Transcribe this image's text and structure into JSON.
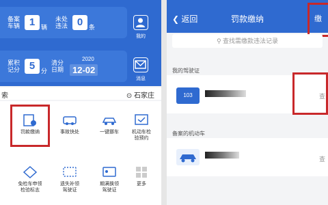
{
  "left": {
    "vehicle_card": {
      "label1": "备案\n车辆",
      "count1": "1",
      "label1b": "辆",
      "label2": "未处\n违法",
      "count2": "0",
      "label2b": "条"
    },
    "points_card": {
      "label1": "累积\n记分",
      "count1": "5",
      "label1b": "分",
      "label2": "清分\n日期",
      "year": "2020",
      "date": "12-02"
    },
    "side_mine": "我的",
    "side_msg": "消息",
    "search_partial": "索",
    "city": "石家庄",
    "tiles": [
      {
        "label": "罚款缴纳"
      },
      {
        "label": "事故快处"
      },
      {
        "label": "一键挪车"
      },
      {
        "label": "机动车检\n验预约"
      },
      {
        "label": "免检车申领\n检验标志"
      },
      {
        "label": "遗失补领\n驾驶证"
      },
      {
        "label": "期满换领\n驾驶证"
      },
      {
        "label": "更多"
      }
    ]
  },
  "right": {
    "back": "返回",
    "title": "罚款缴纳",
    "corner": "缴",
    "search_placeholder": "查找需缴款违法记录",
    "section_license": "我的驾驶证",
    "license_badge": "103",
    "query1": "查",
    "section_vehicle": "备案的机动车",
    "query2": "查"
  },
  "colors": {
    "primary": "#2f6ad0",
    "highlight": "#c8282a"
  }
}
